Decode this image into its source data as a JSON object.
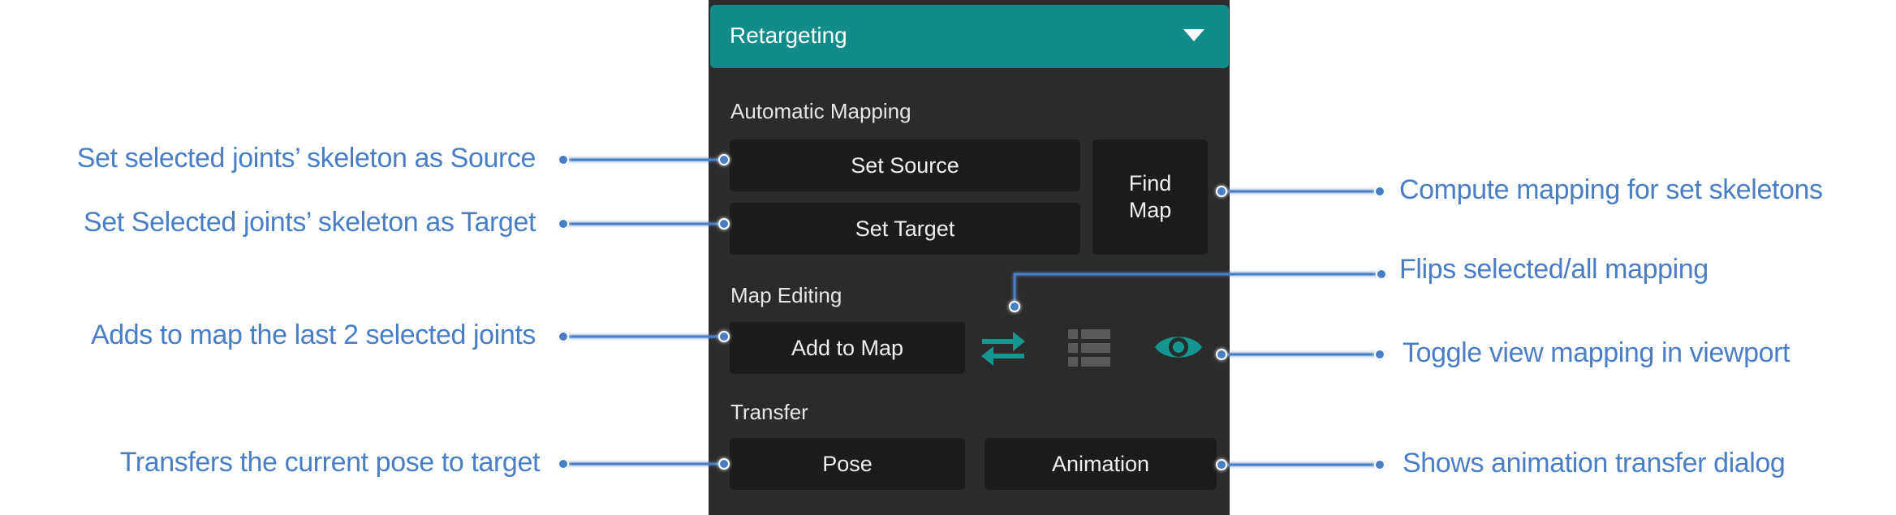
{
  "panel": {
    "title": "Retargeting",
    "header_color": "#128c8a",
    "accent_icon_color": "#169691",
    "sections": {
      "automatic_mapping": "Automatic Mapping",
      "map_editing": "Map Editing",
      "transfer": "Transfer"
    },
    "buttons": {
      "set_source": "Set Source",
      "set_target": "Set Target",
      "find_map": "Find\nMap",
      "add_to_map": "Add to Map",
      "pose": "Pose",
      "animation": "Animation"
    },
    "icons": {
      "caret": "caret-down-icon",
      "flip": "swap-arrows-icon",
      "list": "list-view-icon",
      "eye": "eye-icon"
    }
  },
  "annotations": {
    "set_source": "Set selected joints’ skeleton as Source",
    "set_target": "Set Selected joints’ skeleton as Target",
    "add_to_map": "Adds to map the last 2 selected joints",
    "pose": "Transfers the current pose to target",
    "find_map": "Compute mapping for set skeletons",
    "flip": "Flips selected/all mapping",
    "toggle_view": "Toggle view mapping in viewport",
    "animation": "Shows animation transfer dialog",
    "color": "#4a7ec4"
  }
}
